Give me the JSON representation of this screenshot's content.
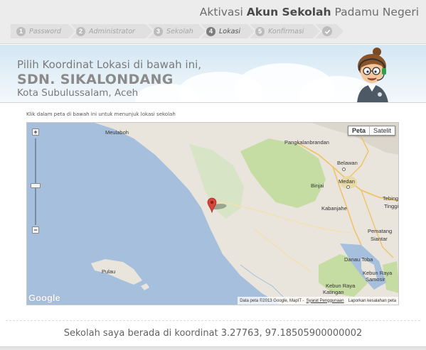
{
  "header": {
    "title_pre": "Aktivasi ",
    "title_bold": "Akun Sekolah",
    "title_post": " Padamu Negeri"
  },
  "steps": [
    {
      "num": "1",
      "label": "Password",
      "active": false
    },
    {
      "num": "2",
      "label": "Administrator",
      "active": false
    },
    {
      "num": "3",
      "label": "Sekolah",
      "active": false
    },
    {
      "num": "4",
      "label": "Lokasi",
      "active": true
    },
    {
      "num": "5",
      "label": "Konfirmasi",
      "active": false
    }
  ],
  "final_step_icon": "check-icon",
  "banner": {
    "instruction": "Pilih Koordinat Lokasi di bawah ini,",
    "school_name": "SDN. SIKALONDANG",
    "location": "Kota Subulussalam, Aceh"
  },
  "map": {
    "hint": "Klik dalam peta di bawah ini untuk menunjuk lokasi sekolah",
    "type_controls": {
      "map": "Peta",
      "satellite": "Satelit",
      "selected": "Peta"
    },
    "zoom_in": "+",
    "zoom_out": "−",
    "logo": "Google",
    "attribution": "Data peta ©2013 Google, MapIT -",
    "terms_link": "Syarat Penggunaan",
    "report_link": "Laporkan kesalahan peta",
    "places": {
      "meulaboh": "Meulaboh",
      "pangkalanbrandan": "Pangkalanbrandan",
      "belawan": "Belawan",
      "binjai": "Binjai",
      "medan": "Medan",
      "tebing": "Tebing",
      "tinggi": "Tinggi",
      "kabanjahe": "Kabanjahe",
      "pematang": "Pematang",
      "siantar": "Siantar",
      "danau": "Danau Toba",
      "pulau": "Pulau",
      "kebun1": "Kebun Raya",
      "katingan": "Katingan",
      "kebun2": "Kebun Raya",
      "samosir": "Samosir"
    },
    "marker_icon": "map-pin-icon"
  },
  "footer": {
    "coordinate_text": "Sekolah saya berada di koordinat 3.27763, 97.18505900000002"
  },
  "colors": {
    "header_bg": "#ececec",
    "step_bg": "#e0e0e0",
    "active_step_num": "#7d7d7d",
    "marker": "#d9453d",
    "sea": "#a5bfdd",
    "land": "#e9e5dc",
    "park": "#c5dca3"
  }
}
